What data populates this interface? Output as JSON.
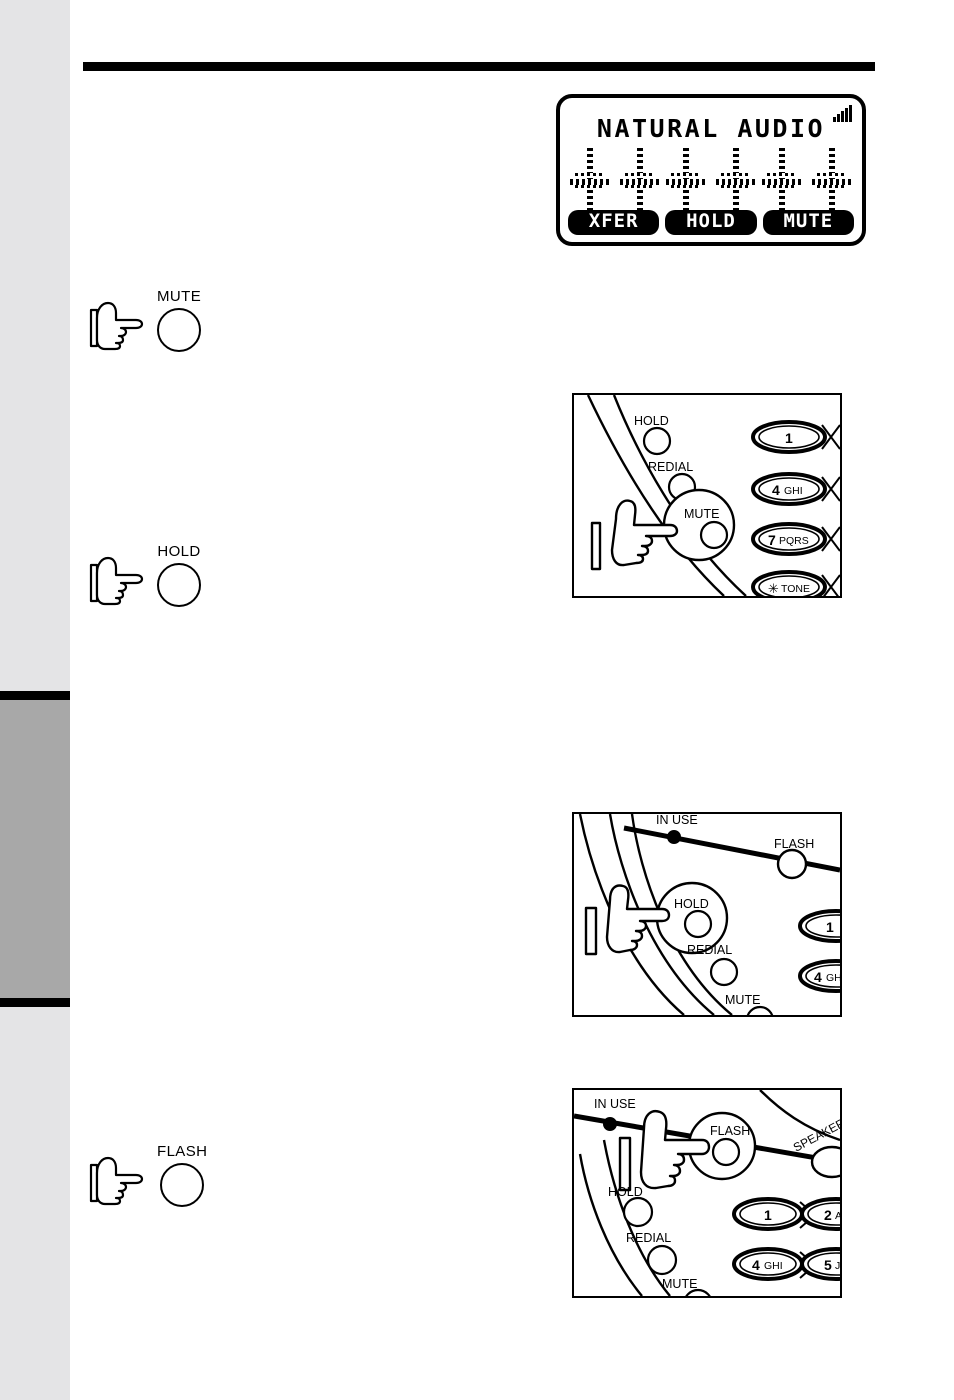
{
  "page": {
    "background_color": "#ffffff",
    "edge_strip_color": "#e4e4e6",
    "index_tab_color": "#a8a8a8",
    "rule_color": "#000000"
  },
  "lcd": {
    "title": "NATURAL AUDIO",
    "signal_icon": "signal-strength-icon",
    "signal_bars": 5,
    "indicator_symbols": [
      "cross-arrow",
      "cross-arrow",
      "cross-arrow",
      "cross-arrow",
      "cross-arrow",
      "cross-arrow"
    ],
    "softkeys": [
      {
        "label": "XFER",
        "name": "softkey-xfer"
      },
      {
        "label": "HOLD",
        "name": "softkey-hold"
      },
      {
        "label": "MUTE",
        "name": "softkey-mute"
      }
    ]
  },
  "instructions": [
    {
      "key_label": "MUTE",
      "hand": "pointing-hand-icon",
      "name": "instruction-mute"
    },
    {
      "key_label": "HOLD",
      "hand": "pointing-hand-icon",
      "name": "instruction-hold"
    },
    {
      "key_label": "FLASH",
      "hand": "pointing-hand-icon",
      "name": "instruction-flash"
    }
  ],
  "figures": [
    {
      "name": "figure-press-mute",
      "pressed_key": "MUTE",
      "labels": [
        "HOLD",
        "REDIAL",
        "MUTE"
      ],
      "keypad": [
        {
          "digit": "1",
          "letters": ""
        },
        {
          "digit": "4",
          "letters": "GHI"
        },
        {
          "digit": "7",
          "letters": "PQRS"
        },
        {
          "digit": "✱",
          "letters": "TONE"
        }
      ]
    },
    {
      "name": "figure-press-hold",
      "pressed_key": "HOLD",
      "labels": [
        "IN USE",
        "FLASH",
        "HOLD",
        "REDIAL",
        "MUTE"
      ],
      "keypad": [
        {
          "digit": "1",
          "letters": ""
        },
        {
          "digit": "4",
          "letters": "GH"
        }
      ]
    },
    {
      "name": "figure-press-flash",
      "pressed_key": "FLASH",
      "labels": [
        "IN USE",
        "FLASH",
        "SPEAKER",
        "HOLD",
        "REDIAL",
        "MUTE"
      ],
      "keypad": [
        {
          "digit": "1",
          "letters": ""
        },
        {
          "digit": "2",
          "letters": "A"
        },
        {
          "digit": "4",
          "letters": "GHI"
        },
        {
          "digit": "5",
          "letters": "J"
        }
      ]
    }
  ]
}
